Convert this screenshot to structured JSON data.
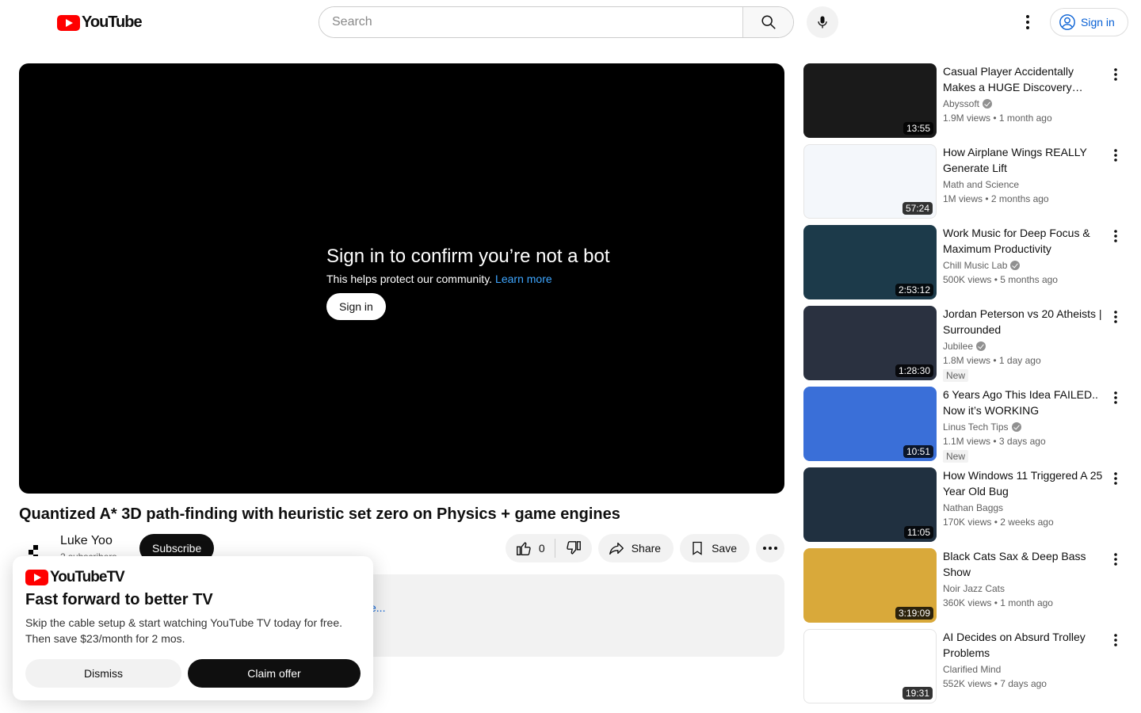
{
  "header": {
    "logo_text": "YouTube",
    "search_placeholder": "Search",
    "signin_label": "Sign in"
  },
  "player": {
    "bot_title": "Sign in to confirm you’re not a bot",
    "bot_sub": "This helps protect our community.",
    "learn_more": "Learn more",
    "signin_label": "Sign in"
  },
  "video": {
    "title": "Quantized A* 3D path-finding with heuristic set zero on Physics + game engines",
    "channel_name": "Luke Yoo",
    "channel_subs": "2 subscribers",
    "subscribe_label": "Subscribe",
    "like_count": "0",
    "share_label": "Share",
    "save_label": "Save",
    "desc_more": "e..."
  },
  "tv_popup": {
    "logo_text": "YouTubeTV",
    "headline": "Fast forward to better TV",
    "body": "Skip the cable setup & start watching YouTube TV today for free. Then save $23/month for 2 mos.",
    "dismiss_label": "Dismiss",
    "claim_label": "Claim offer"
  },
  "recommendations": [
    {
      "title": "Casual Player Accidentally Makes a HUGE Discovery That…",
      "channel": "Abyssoft",
      "verified": true,
      "views": "1.9M views",
      "age": "1 month ago",
      "duration": "13:55",
      "badge": "",
      "thumb_color": "#1a1a1a"
    },
    {
      "title": "How Airplane Wings REALLY Generate Lift",
      "channel": "Math and Science",
      "verified": false,
      "views": "1M views",
      "age": "2 months ago",
      "duration": "57:24",
      "badge": "",
      "thumb_color": "#f4f7fb"
    },
    {
      "title": "Work Music for Deep Focus & Maximum Productivity",
      "channel": "Chill Music Lab",
      "verified": true,
      "views": "500K views",
      "age": "5 months ago",
      "duration": "2:53:12",
      "badge": "",
      "thumb_color": "#1c3a4a"
    },
    {
      "title": "Jordan Peterson vs 20 Atheists | Surrounded",
      "channel": "Jubilee",
      "verified": true,
      "views": "1.8M views",
      "age": "1 day ago",
      "duration": "1:28:30",
      "badge": "New",
      "thumb_color": "#2a3140"
    },
    {
      "title": "6 Years Ago This Idea FAILED.. Now it’s WORKING",
      "channel": "Linus Tech Tips",
      "verified": true,
      "views": "1.1M views",
      "age": "3 days ago",
      "duration": "10:51",
      "badge": "New",
      "thumb_color": "#3a6fd8"
    },
    {
      "title": "How Windows 11 Triggered A 25 Year Old Bug",
      "channel": "Nathan Baggs",
      "verified": false,
      "views": "170K views",
      "age": "2 weeks ago",
      "duration": "11:05",
      "badge": "",
      "thumb_color": "#203040"
    },
    {
      "title": "Black Cats Sax & Deep Bass Show",
      "channel": "Noir Jazz Cats",
      "verified": false,
      "views": "360K views",
      "age": "1 month ago",
      "duration": "3:19:09",
      "badge": "",
      "thumb_color": "#d9a93a"
    },
    {
      "title": "AI Decides on Absurd Trolley Problems",
      "channel": "Clarified Mind",
      "verified": false,
      "views": "552K views",
      "age": "7 days ago",
      "duration": "19:31",
      "badge": "",
      "thumb_color": "#ffffff"
    }
  ]
}
